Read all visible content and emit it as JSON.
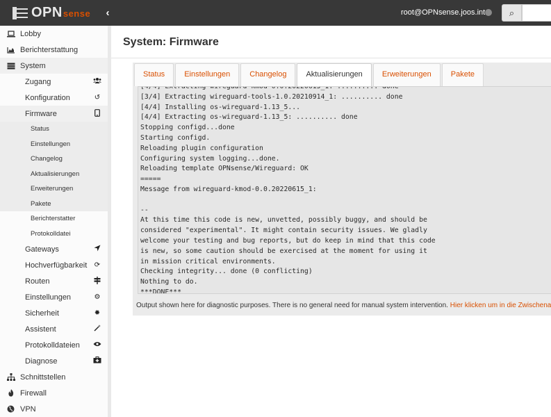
{
  "header": {
    "logo_text": "OPN",
    "logo_sub": "sense",
    "collapse": "‹",
    "user": "root@OPNsense.joos.int",
    "search_icon": "⌕",
    "search_placeholder": ""
  },
  "sidebar": {
    "top": [
      {
        "label": "Lobby",
        "icon": "laptop-icon"
      },
      {
        "label": "Berichterstattung",
        "icon": "area-chart-icon"
      },
      {
        "label": "System",
        "icon": "server-icon"
      }
    ],
    "system_sub": [
      {
        "label": "Zugang",
        "icon": "users-icon",
        "glyph": "👥"
      },
      {
        "label": "Konfiguration",
        "icon": "history-icon",
        "glyph": "↺"
      },
      {
        "label": "Firmware",
        "icon": "mobile-icon",
        "glyph": "▯"
      }
    ],
    "firmware_sub": [
      "Status",
      "Einstellungen",
      "Changelog",
      "Aktualisierungen",
      "Erweiterungen",
      "Pakete",
      "Berichterstatter",
      "Protokolldatei"
    ],
    "system_sub2": [
      {
        "label": "Gateways",
        "icon": "location-arrow-icon",
        "glyph": "➤"
      },
      {
        "label": "Hochverfügbarkeit",
        "icon": "refresh-icon",
        "glyph": "⟳"
      },
      {
        "label": "Routen",
        "icon": "map-signs-icon",
        "glyph": "⇹"
      },
      {
        "label": "Einstellungen",
        "icon": "cogs-icon",
        "glyph": "⚙"
      },
      {
        "label": "Sicherheit",
        "icon": "certificate-icon",
        "glyph": "✹"
      },
      {
        "label": "Assistent",
        "icon": "magic-icon",
        "glyph": "⁄"
      },
      {
        "label": "Protokolldateien",
        "icon": "eye-icon",
        "glyph": "◉"
      },
      {
        "label": "Diagnose",
        "icon": "medkit-icon",
        "glyph": "▣"
      }
    ],
    "bottom": [
      {
        "label": "Schnittstellen",
        "icon": "sitemap-icon",
        "glyph": "⊞"
      },
      {
        "label": "Firewall",
        "icon": "fire-icon",
        "glyph": "♨"
      },
      {
        "label": "VPN",
        "icon": "globe-icon",
        "glyph": "◍"
      }
    ]
  },
  "page": {
    "title": "System: Firmware",
    "tabs": [
      "Status",
      "Einstellungen",
      "Changelog",
      "Aktualisierungen",
      "Erweiterungen",
      "Pakete"
    ],
    "active_tab": "Aktualisierungen",
    "log_lines": [
      "[4/4] Extracting wireguard-kmod-0.0.20220615_1: .......... done",
      "[3/4] Extracting wireguard-tools-1.0.20210914_1: .......... done",
      "[4/4] Installing os-wireguard-1.13_5...",
      "[4/4] Extracting os-wireguard-1.13_5: .......... done",
      "Stopping configd...done",
      "Starting configd.",
      "Reloading plugin configuration",
      "Configuring system logging...done.",
      "Reloading template OPNsense/Wireguard: OK",
      "=====",
      "Message from wireguard-kmod-0.0.20220615_1:",
      "",
      "--",
      "At this time this code is new, unvetted, possibly buggy, and should be",
      "considered \"experimental\". It might contain security issues. We gladly",
      "welcome your testing and bug reports, but do keep in mind that this code",
      "is new, so some caution should be exercised at the moment for using it",
      "in mission critical environments.",
      "Checking integrity... done (0 conflicting)",
      "Nothing to do.",
      "***DONE***"
    ],
    "note_text": "Output shown here for diagnostic purposes. There is no general need for manual system intervention.",
    "note_link": "Hier klicken um in die Zwischenablage"
  },
  "colors": {
    "accent": "#d94f00",
    "topbar": "#383838"
  }
}
